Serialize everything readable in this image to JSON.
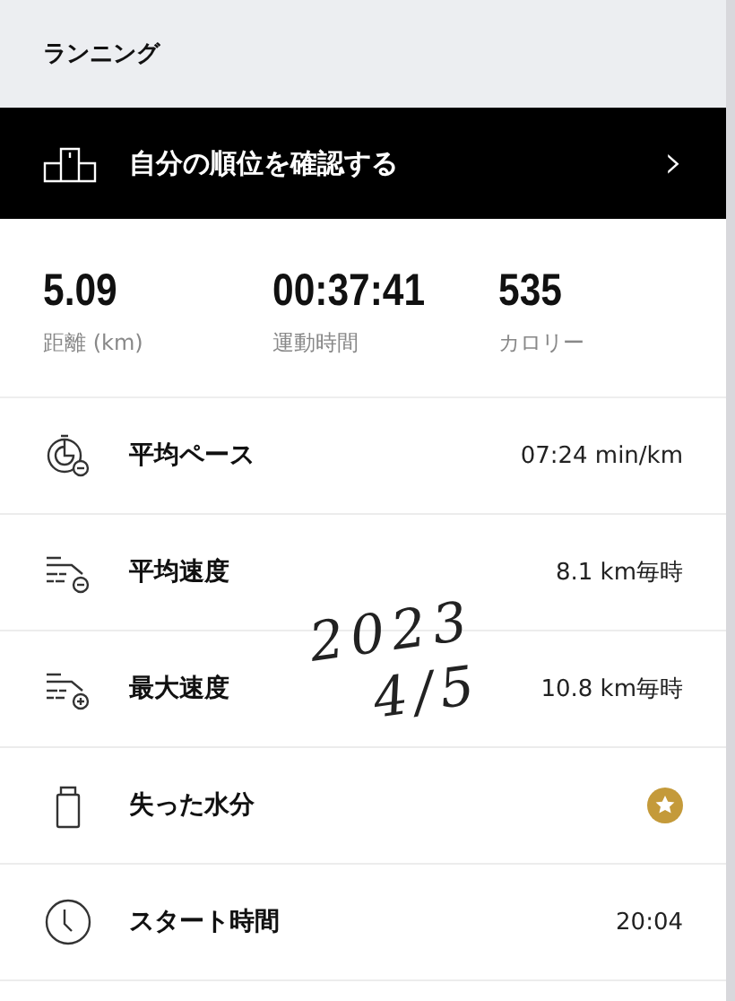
{
  "header": {
    "title": "ランニング"
  },
  "banner": {
    "label": "自分の順位を確認する",
    "chevron": "›"
  },
  "stats": [
    {
      "value": "5.09",
      "label": "距離 (km)"
    },
    {
      "value": "00:37:41",
      "label": "運動時間"
    },
    {
      "value": "535",
      "label": "カロリー"
    }
  ],
  "metrics": [
    {
      "label": "平均ペース",
      "kind": "value",
      "value": "07:24 min/km"
    },
    {
      "label": "平均速度",
      "kind": "value",
      "value": "8.1 km毎時"
    },
    {
      "label": "最大速度",
      "kind": "value",
      "value": "10.8 km毎時"
    },
    {
      "label": "失った水分",
      "kind": "badge"
    },
    {
      "label": "スタート時間",
      "kind": "value",
      "value": "20:04"
    }
  ],
  "handwritten_note": [
    "2023",
    "4/5"
  ]
}
